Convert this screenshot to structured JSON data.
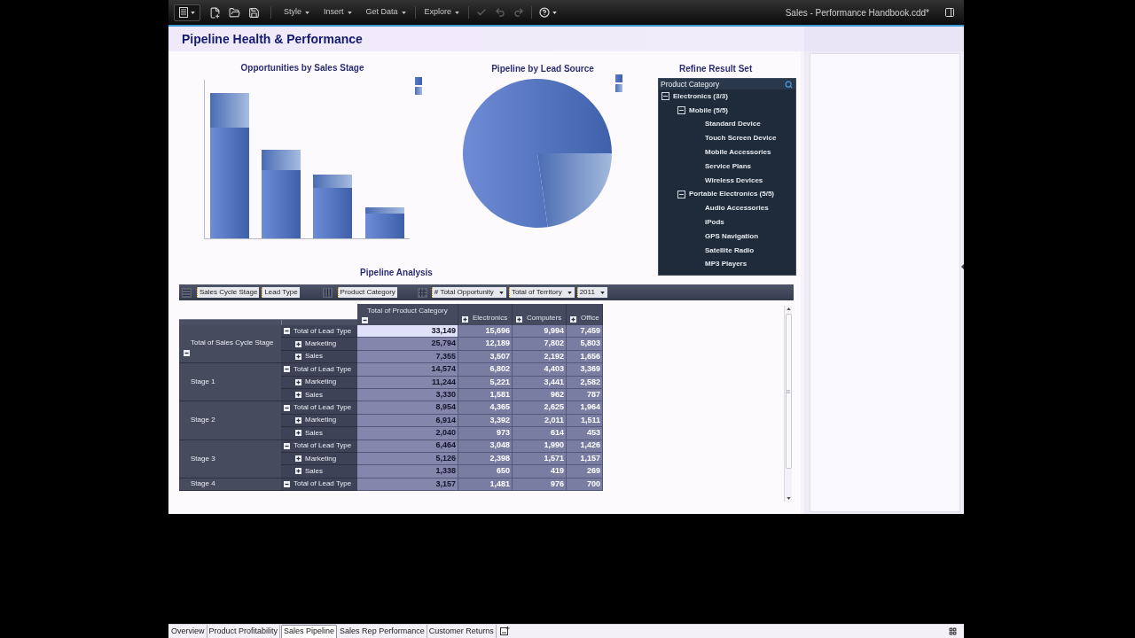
{
  "toolbar": {
    "menu_groups": [
      [
        "Style",
        "Insert",
        "Get Data"
      ],
      [
        "Explore"
      ]
    ],
    "history_buttons": [
      {
        "disabled": true
      },
      {
        "disabled": true
      },
      {
        "disabled": true
      }
    ],
    "document_title": "Sales - Performance Handbook.cdd*"
  },
  "dashboard": {
    "title": "Pipeline Health & Performance",
    "bar_chart": {
      "title": "Opportunities by Sales Stage"
    },
    "pie_chart": {
      "title": "Pipeline by Lead Source"
    },
    "refine": {
      "title": "Refine Result Set",
      "header": "Product Category",
      "tree": [
        {
          "label": "Electronics (3/3)",
          "expanded": true,
          "children": [
            {
              "label": "Mobile (5/5)",
              "expanded": true,
              "children": [
                {
                  "label": "Standard Device"
                },
                {
                  "label": "Touch Screen Device"
                },
                {
                  "label": "Mobile Accessories"
                },
                {
                  "label": "Service Plans"
                },
                {
                  "label": "Wireless Devices"
                }
              ]
            },
            {
              "label": "Portable Electronics (5/5)",
              "expanded": true,
              "children": [
                {
                  "label": "Audio Accessories"
                },
                {
                  "label": "iPods"
                },
                {
                  "label": "GPS Navigation"
                },
                {
                  "label": "Satellite Radio"
                },
                {
                  "label": "MP3 Players"
                }
              ]
            }
          ]
        }
      ]
    },
    "pivot": {
      "title": "Pipeline Analysis",
      "row_fields": [
        "Sales Cycle Stage",
        "Lead Type"
      ],
      "column_fields": [
        "Product Category"
      ],
      "filters": [
        "# Total Opportunity",
        "Total of Territory",
        "2011"
      ],
      "columns": [
        {
          "label": "Total of Product Category",
          "expanded": true
        },
        {
          "label": "Electronics",
          "expanded": false
        },
        {
          "label": "Computers",
          "expanded": false
        },
        {
          "label": "Office",
          "expanded": false
        }
      ],
      "row_groups": [
        {
          "label": "Total of Sales Cycle Stage",
          "toggle": {
            "expanded": true
          },
          "rows": [
            {
              "label": "Total of Lead Type",
              "expanded": true,
              "cells": [
                {
                  "value": "33,149",
                  "selected": true
                },
                {
                  "value": "15,696",
                  "selected": false
                },
                {
                  "value": "9,994",
                  "selected": false
                },
                {
                  "value": "7,459",
                  "selected": false
                }
              ],
              "children": [
                {
                  "label": "Marketing",
                  "expanded": false,
                  "cells": [
                    {
                      "value": "25,794",
                      "selected": false
                    },
                    {
                      "value": "12,189",
                      "selected": false
                    },
                    {
                      "value": "7,802",
                      "selected": false
                    },
                    {
                      "value": "5,803",
                      "selected": false
                    }
                  ]
                },
                {
                  "label": "Sales",
                  "expanded": false,
                  "cells": [
                    {
                      "value": "7,355",
                      "selected": false
                    },
                    {
                      "value": "3,507",
                      "selected": false
                    },
                    {
                      "value": "2,192",
                      "selected": false
                    },
                    {
                      "value": "1,656",
                      "selected": false
                    }
                  ]
                }
              ]
            }
          ]
        },
        {
          "label": "Stage 1",
          "rows": [
            {
              "label": "Total of Lead Type",
              "expanded": true,
              "cells": [
                {
                  "value": "14,574",
                  "selected": false
                },
                {
                  "value": "6,802",
                  "selected": false
                },
                {
                  "value": "4,403",
                  "selected": false
                },
                {
                  "value": "3,369",
                  "selected": false
                }
              ],
              "children": [
                {
                  "label": "Marketing",
                  "expanded": false,
                  "cells": [
                    {
                      "value": "11,244",
                      "selected": false
                    },
                    {
                      "value": "5,221",
                      "selected": false
                    },
                    {
                      "value": "3,441",
                      "selected": false
                    },
                    {
                      "value": "2,582",
                      "selected": false
                    }
                  ]
                },
                {
                  "label": "Sales",
                  "expanded": false,
                  "cells": [
                    {
                      "value": "3,330",
                      "selected": false
                    },
                    {
                      "value": "1,581",
                      "selected": false
                    },
                    {
                      "value": "962",
                      "selected": false
                    },
                    {
                      "value": "787",
                      "selected": false
                    }
                  ]
                }
              ]
            }
          ]
        },
        {
          "label": "Stage 2",
          "rows": [
            {
              "label": "Total of Lead Type",
              "expanded": true,
              "cells": [
                {
                  "value": "8,954",
                  "selected": false
                },
                {
                  "value": "4,365",
                  "selected": false
                },
                {
                  "value": "2,625",
                  "selected": false
                },
                {
                  "value": "1,964",
                  "selected": false
                }
              ],
              "children": [
                {
                  "label": "Marketing",
                  "expanded": false,
                  "cells": [
                    {
                      "value": "6,914",
                      "selected": false
                    },
                    {
                      "value": "3,392",
                      "selected": false
                    },
                    {
                      "value": "2,011",
                      "selected": false
                    },
                    {
                      "value": "1,511",
                      "selected": false
                    }
                  ]
                },
                {
                  "label": "Sales",
                  "expanded": false,
                  "cells": [
                    {
                      "value": "2,040",
                      "selected": false
                    },
                    {
                      "value": "973",
                      "selected": false
                    },
                    {
                      "value": "614",
                      "selected": false
                    },
                    {
                      "value": "453",
                      "selected": false
                    }
                  ]
                }
              ]
            }
          ]
        },
        {
          "label": "Stage 3",
          "rows": [
            {
              "label": "Total of Lead Type",
              "expanded": true,
              "cells": [
                {
                  "value": "6,464",
                  "selected": false
                },
                {
                  "value": "3,048",
                  "selected": false
                },
                {
                  "value": "1,990",
                  "selected": false
                },
                {
                  "value": "1,426",
                  "selected": false
                }
              ],
              "children": [
                {
                  "label": "Marketing",
                  "expanded": false,
                  "cells": [
                    {
                      "value": "5,126",
                      "selected": false
                    },
                    {
                      "value": "2,398",
                      "selected": false
                    },
                    {
                      "value": "1,571",
                      "selected": false
                    },
                    {
                      "value": "1,157",
                      "selected": false
                    }
                  ]
                },
                {
                  "label": "Sales",
                  "expanded": false,
                  "cells": [
                    {
                      "value": "1,338",
                      "selected": false
                    },
                    {
                      "value": "650",
                      "selected": false
                    },
                    {
                      "value": "419",
                      "selected": false
                    },
                    {
                      "value": "269",
                      "selected": false
                    }
                  ]
                }
              ]
            }
          ]
        },
        {
          "label": "Stage 4",
          "rows": [
            {
              "label": "Total of Lead Type",
              "expanded": true,
              "cells": [
                {
                  "value": "3,157",
                  "selected": false
                },
                {
                  "value": "1,481",
                  "selected": false
                },
                {
                  "value": "976",
                  "selected": false
                },
                {
                  "value": "700",
                  "selected": false
                }
              ]
            }
          ]
        }
      ]
    }
  },
  "sheet_tabs": [
    {
      "label": "Overview",
      "selected": false
    },
    {
      "label": "Product Profitability",
      "selected": false
    },
    {
      "label": "Sales Pipeline",
      "selected": true
    },
    {
      "label": "Sales Rep Performance",
      "selected": false
    },
    {
      "label": "Customer Returns",
      "selected": false
    }
  ]
}
